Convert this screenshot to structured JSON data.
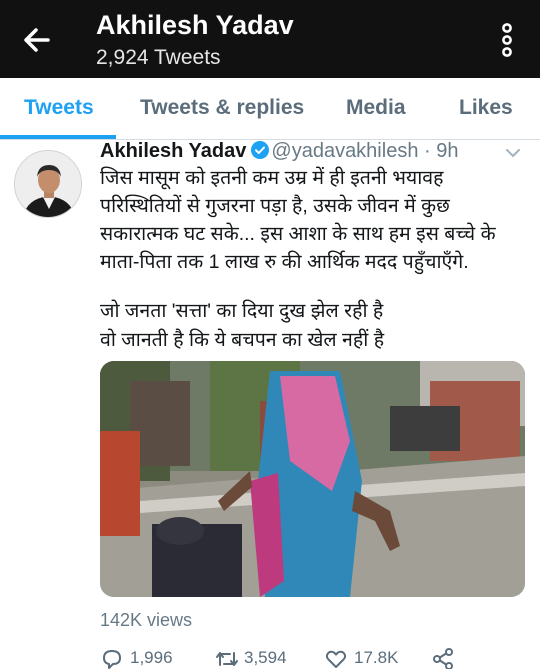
{
  "header": {
    "title": "Akhilesh Yadav",
    "subtitle": "2,924 Tweets",
    "back_icon": "arrow-left-icon",
    "more_icon": "more-vertical-icon"
  },
  "tabs": [
    {
      "label": "Tweets",
      "active": true
    },
    {
      "label": "Tweets & replies",
      "active": false
    },
    {
      "label": "Media",
      "active": false
    },
    {
      "label": "Likes",
      "active": false
    }
  ],
  "tweet": {
    "author": "Akhilesh Yadav",
    "handle": "@yadavakhilesh",
    "separator": "·",
    "time": "9h",
    "text_lines": [
      "जिस मासूम को इतनी कम उम्र में ही इतनी भयावह",
      "परिस्थितियों से गुजरना पड़ा है, उसके जीवन में कुछ",
      "सकारात्मक घट सके... इस आशा के साथ हम इस बच्चे के",
      "माता-पिता तक 1 लाख रु की आर्थिक मदद पहुँचाएँगे.",
      "जो जनता 'सत्ता' का दिया दुख झेल रही है",
      "वो जानती है कि ये बचपन का खेल नहीं है"
    ],
    "views": "142K views",
    "replies": "1,996",
    "retweets": "3,594",
    "likes": "17.8K"
  },
  "colors": {
    "accent": "#1da1f2",
    "header_bg": "#111111",
    "muted": "#687986"
  }
}
